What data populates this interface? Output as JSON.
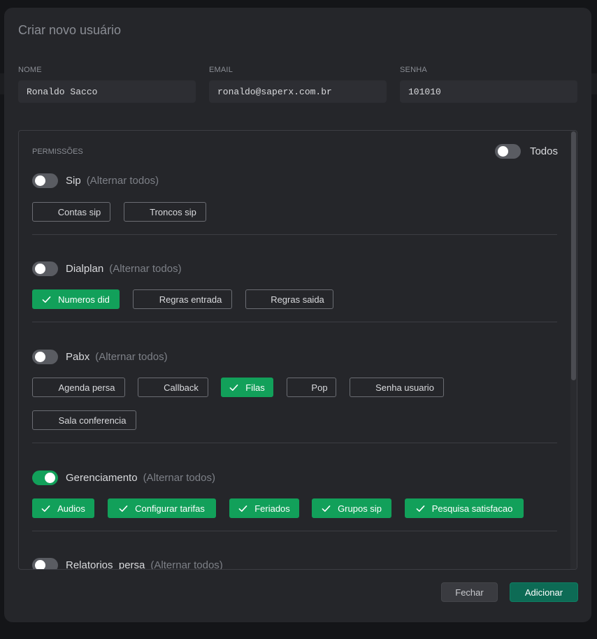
{
  "modal": {
    "title": "Criar novo usuário",
    "fields": [
      {
        "label": "NOME",
        "value": "Ronaldo Sacco"
      },
      {
        "label": "EMAIL",
        "value": "ronaldo@saperx.com.br"
      },
      {
        "label": "SENHA",
        "value": "101010"
      }
    ],
    "permissions_label": "PERMISSÕES",
    "all_label": "Todos",
    "all_on": false,
    "toggle_all_text": "(Alternar todos)",
    "sections": [
      {
        "name": "Sip",
        "on": false,
        "items": [
          {
            "label": "Contas sip",
            "checked": false
          },
          {
            "label": "Troncos sip",
            "checked": false
          }
        ]
      },
      {
        "name": "Dialplan",
        "on": false,
        "items": [
          {
            "label": "Numeros did",
            "checked": true
          },
          {
            "label": "Regras entrada",
            "checked": false
          },
          {
            "label": "Regras saida",
            "checked": false
          }
        ]
      },
      {
        "name": "Pabx",
        "on": false,
        "items": [
          {
            "label": "Agenda persa",
            "checked": false
          },
          {
            "label": "Callback",
            "checked": false
          },
          {
            "label": "Filas",
            "checked": true
          },
          {
            "label": "Pop",
            "checked": false
          },
          {
            "label": "Senha usuario",
            "checked": false
          },
          {
            "label": "Sala conferencia",
            "checked": false
          }
        ]
      },
      {
        "name": "Gerenciamento",
        "on": true,
        "items": [
          {
            "label": "Audios",
            "checked": true
          },
          {
            "label": "Configurar tarifas",
            "checked": true
          },
          {
            "label": "Feriados",
            "checked": true
          },
          {
            "label": "Grupos sip",
            "checked": true
          },
          {
            "label": "Pesquisa satisfacao",
            "checked": true
          }
        ]
      },
      {
        "name": "Relatorios_persa",
        "on": false,
        "items": []
      }
    ],
    "buttons": {
      "close": "Fechar",
      "add": "Adicionar"
    }
  },
  "colors": {
    "accent_green": "#12a05a",
    "primary_button": "#0d6b55"
  },
  "icons": {
    "check": "check-icon"
  }
}
